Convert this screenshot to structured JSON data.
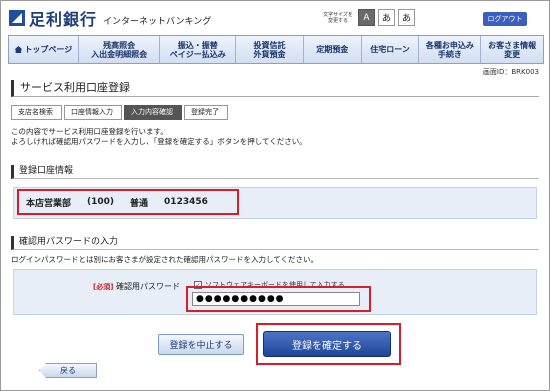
{
  "header": {
    "bank_name": "足利銀行",
    "service_name": "インターネットバンキング",
    "font_size_label": "文字サイズを変更する",
    "font_sizes": [
      "A",
      "あ",
      "あ"
    ],
    "logout": "ログアウト"
  },
  "nav": {
    "items": [
      {
        "label": "トップページ"
      },
      {
        "label": "残高照会\n入出金明細照会"
      },
      {
        "label": "振込・振替\nペイジー払込み"
      },
      {
        "label": "投資信託\n外貨預金"
      },
      {
        "label": "定期預金"
      },
      {
        "label": "住宅ローン"
      },
      {
        "label": "各種お申込み\n手続き"
      },
      {
        "label": "お客さま情報\n変更"
      }
    ]
  },
  "screen_id": "画面ID：BRK003",
  "page_title": "サービス利用口座登録",
  "steps": [
    "支店名検索",
    "口座情報入力",
    "入力内容確認",
    "登録完了"
  ],
  "intro": {
    "line1": "この内容でサービス利用口座登録を行います。",
    "line2": "よろしければ確認用パスワードを入力し、「登録を確定する」ボタンを押してください。"
  },
  "account_section": {
    "title": "登録口座情報",
    "branch": "本店営業部",
    "branch_code": "(100)",
    "type": "普通",
    "number": "0123456"
  },
  "password_section": {
    "title": "確認用パスワードの入力",
    "description": "ログインパスワードとは別にお客さまが設定された確認用パスワードを入力してください。",
    "required": "[必須]",
    "label": "確認用パスワード",
    "software_keyboard": "ソフトウェアキーボードを使用して入力する",
    "value": "●●●●●●●●●●"
  },
  "buttons": {
    "cancel": "登録を中止する",
    "confirm": "登録を確定する",
    "back": "戻る"
  }
}
